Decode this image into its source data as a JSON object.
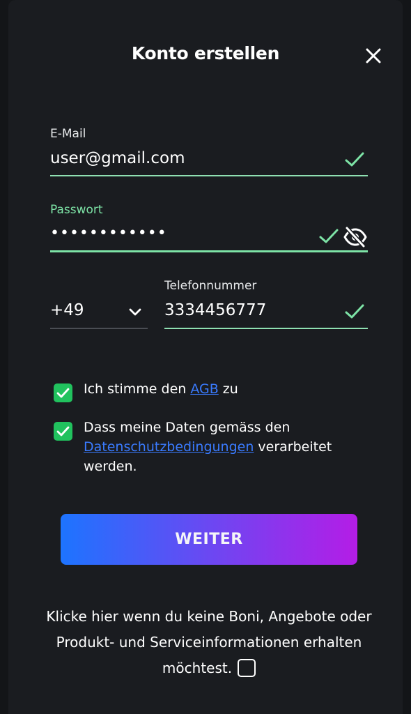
{
  "modal": {
    "title": "Konto erstellen",
    "close_icon": "close-icon"
  },
  "email": {
    "label": "E-Mail",
    "value": "user@gmail.com",
    "status_icon": "checkmark-icon"
  },
  "password": {
    "label": "Passwort",
    "value": "••••••••••••",
    "status_icon": "checkmark-icon",
    "toggle_icon": "eye-off-icon"
  },
  "phone": {
    "country_code": "+49",
    "label": "Telefonnummer",
    "value": "3334456777",
    "status_icon": "checkmark-icon"
  },
  "consents": [
    {
      "checked": true,
      "text_before": "Ich stimme den ",
      "link": "AGB",
      "text_after": " zu"
    },
    {
      "checked": true,
      "text_before": "Dass meine Daten gemäss den ",
      "link": "Datenschutzbedingungen",
      "text_after": " verarbeitet werden."
    }
  ],
  "submit": {
    "label": "WEITER"
  },
  "optout": {
    "text": "Klicke hier wenn du keine Boni, Angebote oder Produkt- und Serviceinformationen erhalten möchtest.",
    "checked": false
  },
  "colors": {
    "background": "#1a1c20",
    "success_green": "#7de3a6",
    "checkbox_green": "#21c25e",
    "link_blue": "#3a7bff",
    "button_gradient_start": "#1d74ff",
    "button_gradient_end": "#b41de6"
  }
}
